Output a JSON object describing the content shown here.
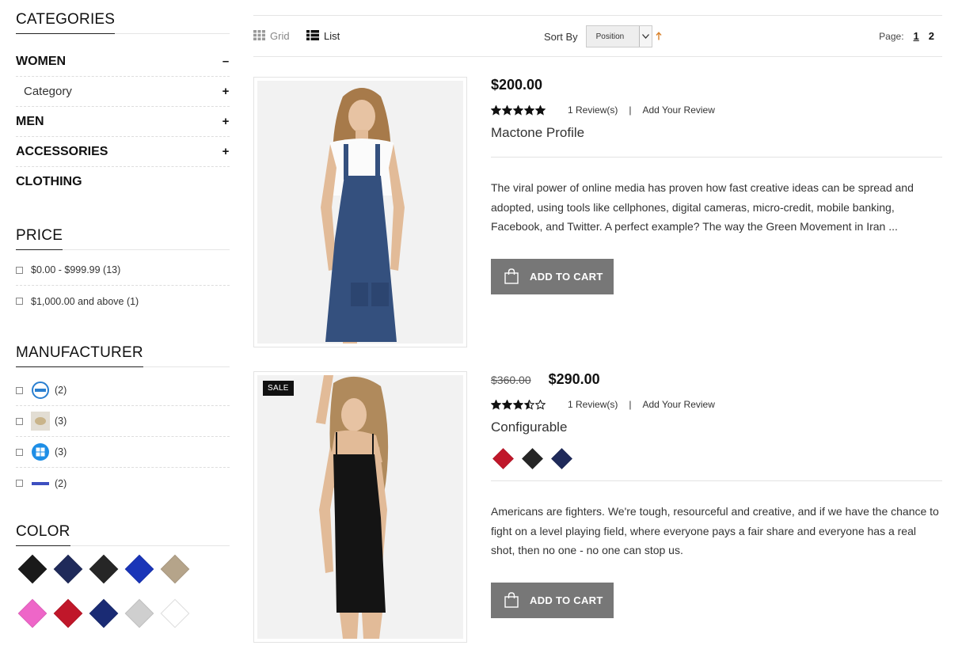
{
  "sidebar": {
    "categories": {
      "title": "CATEGORIES",
      "items": [
        {
          "label": "WOMEN",
          "sign": "–"
        },
        {
          "label": "Category",
          "sign": "+"
        },
        {
          "label": "MEN",
          "sign": "+"
        },
        {
          "label": "ACCESSORIES",
          "sign": "+"
        },
        {
          "label": "CLOTHING",
          "sign": ""
        }
      ]
    },
    "price": {
      "title": "PRICE",
      "items": [
        {
          "label": "$0.00 - $999.99 (13)"
        },
        {
          "label": "$1,000.00 and above (1)"
        }
      ]
    },
    "manufacturer": {
      "title": "MANUFACTURER",
      "items": [
        {
          "logo": "dell-logo",
          "count": "(2)"
        },
        {
          "logo": "brand-logo",
          "count": "(3)"
        },
        {
          "logo": "windows-logo",
          "count": "(3)"
        },
        {
          "logo": "nokia-logo",
          "count": "(2)"
        }
      ]
    },
    "color": {
      "title": "COLOR",
      "swatches": [
        "#1a1a1a",
        "#1f2a5a",
        "#262626",
        "#1a35b8",
        "#b5a48a",
        "#ee66c8",
        "#c0172a",
        "#1a2b74",
        "#cfcfcf",
        "#ffffff"
      ]
    }
  },
  "toolbar": {
    "grid_label": "Grid",
    "list_label": "List",
    "sort_label": "Sort By",
    "sort_value": "Position",
    "page_label": "Page:",
    "pages": [
      "1",
      "2"
    ]
  },
  "products": [
    {
      "price": "$200.00",
      "old_price": "",
      "rating": 5,
      "reviews": "1 Review(s)",
      "add_review": "Add Your Review",
      "name": "Mactone Profile",
      "swatches": [],
      "description": "The viral power of online media has proven how fast creative ideas can be spread and adopted, using tools like cellphones, digital cameras, micro-credit, mobile banking, Facebook, and Twitter. A perfect example? The way the Green Movement in Iran ...",
      "cart_label": "ADD TO CART",
      "sale": ""
    },
    {
      "price": "$290.00",
      "old_price": "$360.00",
      "rating": 3.5,
      "reviews": "1 Review(s)",
      "add_review": "Add Your Review",
      "name": "Configurable",
      "swatches": [
        "#c0172a",
        "#262626",
        "#1f2a5a"
      ],
      "description": "Americans are fighters. We're tough, resourceful and creative, and if we have the chance to fight on a level playing field, where everyone pays a fair share and everyone has a real shot, then no one - no one can stop us.",
      "cart_label": "ADD TO CART",
      "sale": "SALE"
    }
  ]
}
